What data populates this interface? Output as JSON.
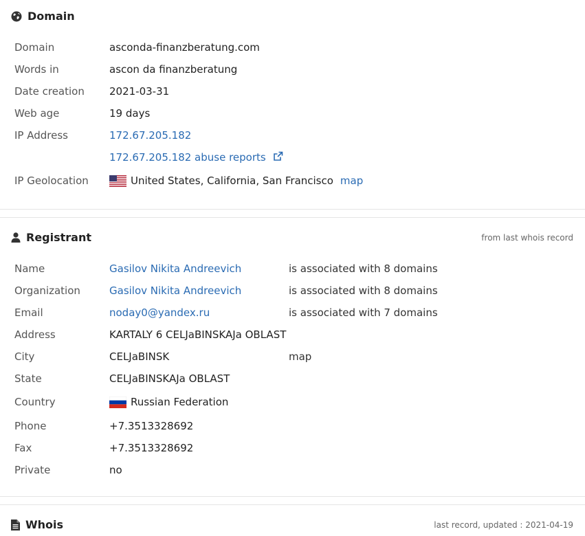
{
  "domain_section": {
    "title": "Domain",
    "rows": {
      "domain": {
        "label": "Domain",
        "value": "asconda-finanzberatung.com"
      },
      "words_in": {
        "label": "Words in",
        "value": "ascon da finanzberatung"
      },
      "date_creation": {
        "label": "Date creation",
        "value": "2021-03-31"
      },
      "web_age": {
        "label": "Web age",
        "value": "19 days"
      },
      "ip_address": {
        "label": "IP Address",
        "value": "172.67.205.182",
        "abuse_link": "172.67.205.182 abuse reports"
      },
      "ip_geolocation": {
        "label": "IP Geolocation",
        "value": "United States, California, San Francisco",
        "map_link": "map",
        "flag": "us-flag-icon"
      }
    }
  },
  "registrant_section": {
    "title": "Registrant",
    "note": "from last whois record",
    "rows": {
      "name": {
        "label": "Name",
        "value": "Gasilov Nikita Andreevich",
        "assoc": "is associated with 8 domains"
      },
      "organization": {
        "label": "Organization",
        "value": "Gasilov Nikita Andreevich",
        "assoc": "is associated with 8 domains"
      },
      "email": {
        "label": "Email",
        "value": "noday0@yandex.ru",
        "assoc": "is associated with 7 domains"
      },
      "address": {
        "label": "Address",
        "value": "KARTALY 6 CELJaBINSKAJa OBLAST"
      },
      "city": {
        "label": "City",
        "value": "CELJaBINSK",
        "map_link": "map"
      },
      "state": {
        "label": "State",
        "value": "CELJaBINSKAJa OBLAST"
      },
      "country": {
        "label": "Country",
        "value": "Russian Federation",
        "flag": "ru-flag-icon"
      },
      "phone": {
        "label": "Phone",
        "value": "+7.3513328692"
      },
      "fax": {
        "label": "Fax",
        "value": "+7.3513328692"
      },
      "private": {
        "label": "Private",
        "value": "no"
      }
    }
  },
  "whois_section": {
    "title": "Whois",
    "note": "last record, updated : 2021-04-19"
  },
  "colors": {
    "link": "#2a6bb3",
    "label": "#555555",
    "divider": "#e4e4e4"
  }
}
